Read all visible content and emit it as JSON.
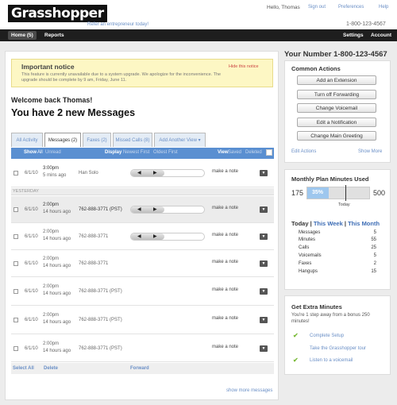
{
  "brand": {
    "logo": "Grasshopper",
    "tagline": "Refer an entrepreneur today!"
  },
  "header": {
    "greeting": "Hello, Thomas",
    "links": [
      "Sign out",
      "Preferences",
      "Help"
    ],
    "phone": "1-800-123-4567"
  },
  "nav": {
    "left": [
      "Home (5)",
      "Reports"
    ],
    "right": [
      "Settings",
      "Account"
    ]
  },
  "notice": {
    "title": "Important notice",
    "hide": "Hide this notice",
    "text": "This feature is currently unavailable due to a system upgrade. We apologize for the inconvenience. The upgrade should be complete by 9 am, Friday, June 11."
  },
  "welcome": "Welcome back Thomas!",
  "new_messages": "You have 2 new Messages",
  "tabs": [
    "All Activity",
    "Messages (2)",
    "Faxes (2)",
    "Missed Calls (8)",
    "Add Another View ▾"
  ],
  "filter": {
    "show": "Show",
    "show_all": "All",
    "show_unread": "Unread",
    "display": "Display",
    "newest": "Newest First",
    "oldest": "Oldest First",
    "view": "View",
    "saved": "Saved",
    "deleted": "Deleted"
  },
  "yesterday_label": "YESTERDAY",
  "messages": [
    {
      "date": "6/1/10",
      "time": "3:00pm",
      "ago": "5 mins ago",
      "caller": "Han Solo",
      "note": "make a note"
    },
    {
      "date": "6/1/10",
      "time": "2:00pm",
      "ago": "14 hours ago",
      "caller": "762-888-3771 (PST)",
      "note": "make a note"
    },
    {
      "date": "6/1/10",
      "time": "2:00pm",
      "ago": "14 hours ago",
      "caller": "762-888-3771",
      "note": "make a note"
    },
    {
      "date": "6/1/10",
      "time": "2:00pm",
      "ago": "14 hours ago",
      "caller": "762-888-3771",
      "note": "make a note"
    },
    {
      "date": "6/1/10",
      "time": "2:00pm",
      "ago": "14 hours ago",
      "caller": "762-888-3771 (PST)",
      "note": "make a note"
    },
    {
      "date": "6/1/10",
      "time": "2:00pm",
      "ago": "14 hours ago",
      "caller": "762-888-3771 (PST)",
      "note": "make a note"
    },
    {
      "date": "6/1/10",
      "time": "2:00pm",
      "ago": "14 hours ago",
      "caller": "762-888-3771 (PST)",
      "note": "make a note"
    }
  ],
  "bulk": {
    "select_all": "Select All",
    "delete": "Delete",
    "forward": "Forward"
  },
  "show_more": "show more messages",
  "sidebar": {
    "your_number": "Your Number 1-800-123-4567",
    "common_actions": "Common Actions",
    "actions": [
      "Add an Extension",
      "Turn off Forwarding",
      "Change Voicemail",
      "Edit a Notification",
      "Change Main Greeting"
    ],
    "edit_actions": "Edit Actions",
    "show_more": "Show More",
    "minutes_title": "Monthly Plan Minutes Used",
    "minutes_used": "175",
    "minutes_pct": "35%",
    "minutes_used_fraction": 0.35,
    "minutes_total": "500",
    "today_label": "Today",
    "periods": [
      "Today",
      "This Week",
      "This Month"
    ],
    "stats": [
      {
        "label": "Messages",
        "value": "5"
      },
      {
        "label": "Minutes",
        "value": "55"
      },
      {
        "label": "Calls",
        "value": "25"
      },
      {
        "label": "Voicemails",
        "value": "5"
      },
      {
        "label": "Faxes",
        "value": "2"
      },
      {
        "label": "Hangups",
        "value": "15"
      }
    ],
    "extra_title": "Get Extra Minutes",
    "extra_text": "You're 1 step away from a bonus 250 minutes!",
    "extra_steps": [
      "Complete Setup",
      "Take the Grasshopper tour",
      "Listen to a voicemail"
    ]
  },
  "colors": {
    "accent": "#5a8fd1",
    "link": "#6a8fc6",
    "notice_bg": "#fdf7c4",
    "check": "#7bbb3a"
  }
}
